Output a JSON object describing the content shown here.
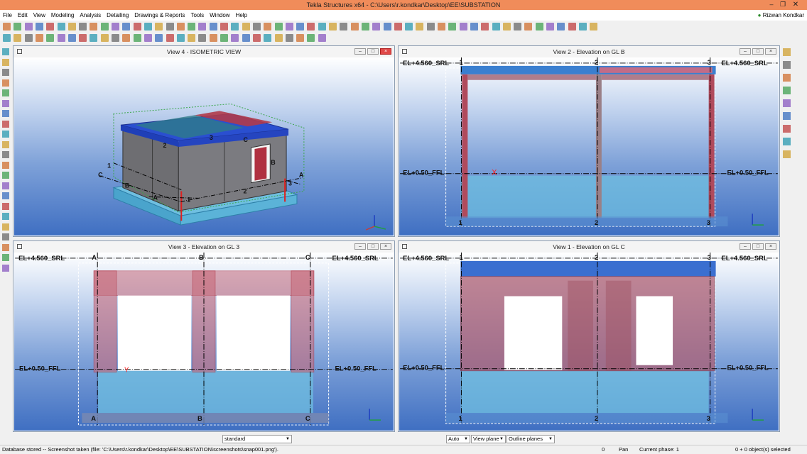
{
  "window": {
    "title": "Tekla Structures x64 - C:\\Users\\r.kondkar\\Desktop\\EE\\SUBSTATION",
    "min_icon": "minimize-icon",
    "max_icon": "maximize-icon",
    "close_icon": "close-icon"
  },
  "menu": {
    "items": [
      "File",
      "Edit",
      "View",
      "Modeling",
      "Analysis",
      "Detailing",
      "Drawings & Reports",
      "Tools",
      "Window",
      "Help"
    ],
    "user": "Rizwan Kondkar"
  },
  "colors": {
    "title_bar": "#f08c5a",
    "view_bg_top": "#ffffff",
    "view_bg_bottom": "#3f6fc2",
    "grid_line": "#000000",
    "rebar": "#c0304a",
    "concrete": "#6fbfe0",
    "roof": "#2a4fd0",
    "close_button": "#e04848",
    "selection": "#ff3030"
  },
  "view_buttons": {
    "min": "–",
    "max": "□",
    "close": "×"
  },
  "views": {
    "iso": {
      "title": "View 4 - ISOMETRIC VIEW",
      "labels": {
        "grid_1_left": "1",
        "grid_c_left": "C",
        "grid_b_left": "B",
        "grid_a_front": "A",
        "grid_2_wall": "2",
        "grid_3_top": "3",
        "grid_c_win": "C",
        "grid_b_win": "B",
        "grid_a_right": "A",
        "grid_3_right": "3",
        "grid_2_front": "2",
        "grid_1_front": "1"
      }
    },
    "v2": {
      "title": "View 2 - Elevation on  GL B",
      "lvl_top": "EL+4.560_SRL",
      "lvl_bot": "EL+0.50_FFL",
      "grids": [
        "1",
        "2",
        "3"
      ],
      "marker": "X"
    },
    "v3": {
      "title": "View 3 - Elevation on GL 3",
      "lvl_top": "EL+4.560_SRL",
      "lvl_bot": "EL+0.50_FFL",
      "grids": [
        "A",
        "B",
        "C"
      ],
      "marker": "Y"
    },
    "v1": {
      "title": "View 1 - Elevation on GL C",
      "lvl_top": "EL+4.560_SRL",
      "lvl_bot": "EL+0.50_FFL",
      "grids": [
        "1",
        "2",
        "3"
      ]
    }
  },
  "bottom_toolbar": {
    "filter": "standard",
    "snap_auto": "Auto",
    "plane": "View plane",
    "outline": "Outline planes"
  },
  "status": {
    "message": "Database stored -- Screenshot taken (file: 'C:\\Users\\r.kondkar\\Desktop\\EE\\SUBSTATION\\screenshots\\snap001.png').",
    "count": "0",
    "mode": "Pan",
    "phase": "Current phase: 1",
    "selected": "0 + 0 object(s) selected"
  }
}
